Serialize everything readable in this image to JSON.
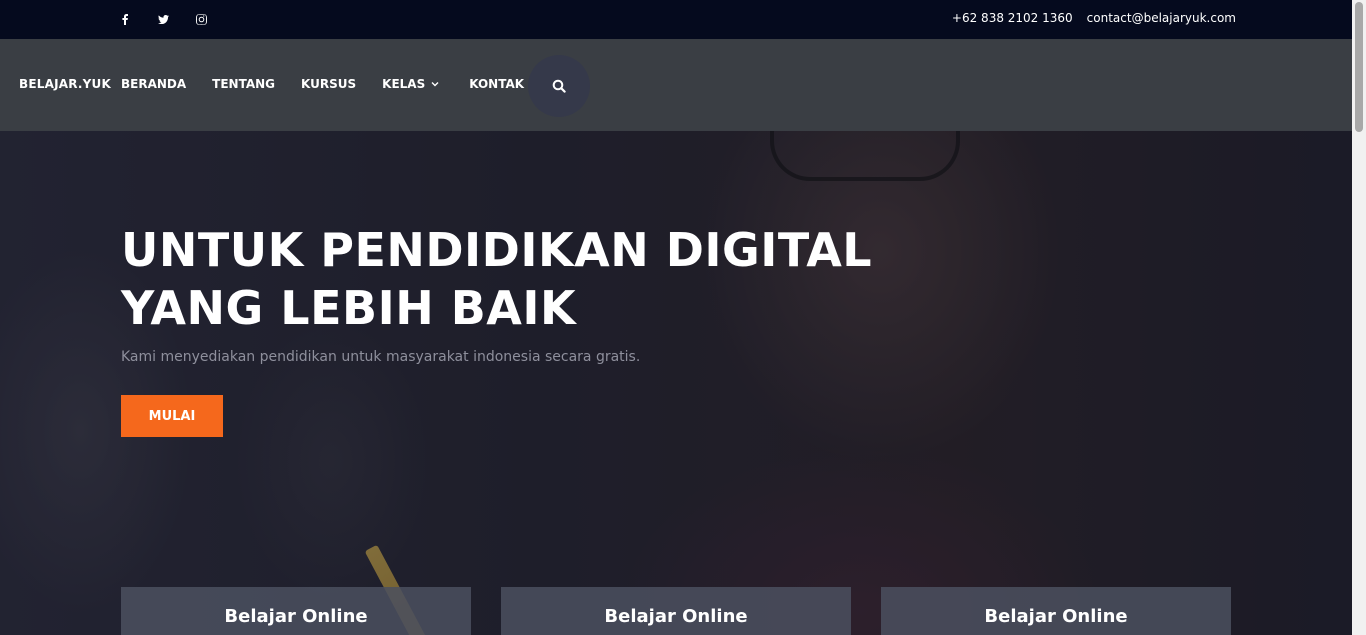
{
  "topbar": {
    "social": [
      {
        "icon": "facebook-icon"
      },
      {
        "icon": "twitter-icon"
      },
      {
        "icon": "instagram-icon"
      }
    ],
    "phone": "+62 838 2102 1360",
    "email": "contact@belajaryuk.com"
  },
  "nav": {
    "brand": "BELAJAR.YUK",
    "items": [
      "BERANDA",
      "TENTANG",
      "KURSUS",
      "KELAS",
      "KONTAK"
    ],
    "search_icon": "search-icon"
  },
  "hero": {
    "headline": "UNTUK PENDIDIKAN DIGITAL YANG LEBIH BAIK",
    "subtext": "Kami menyediakan pendidikan untuk masyarakat indonesia secara gratis.",
    "cta": "MULAI"
  },
  "cards": [
    "Belajar Online",
    "Belajar Online",
    "Belajar Online"
  ],
  "colors": {
    "topbar_bg": "#050a1e",
    "nav_bg": "#3a3e44",
    "accent": "#f5681c"
  }
}
